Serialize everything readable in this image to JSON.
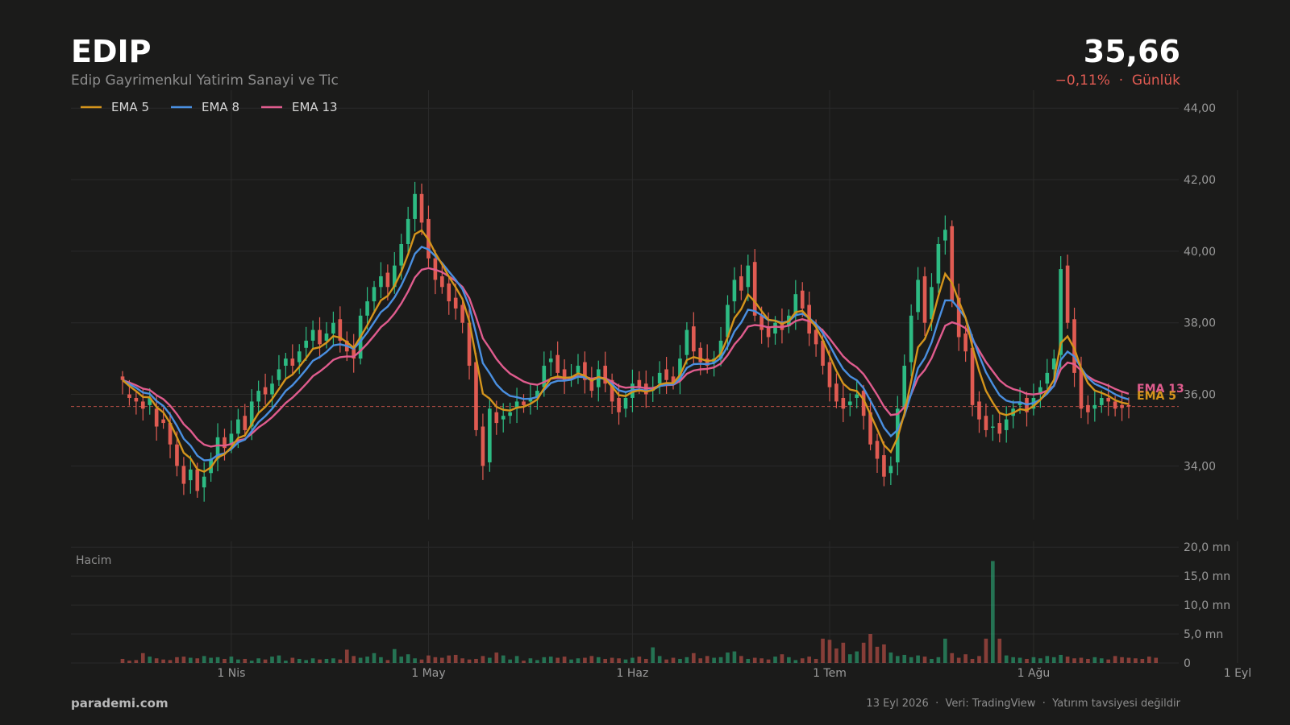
{
  "header": {
    "ticker": "EDIP",
    "company": "Edip Gayrimenkul Yatirim Sanayi ve Tic",
    "price": "35,66",
    "change": "−0,11%",
    "period": "Günlük"
  },
  "footer": {
    "brand": "parademi.com",
    "date": "13 Eyl 2026",
    "source": "Veri: TradingView",
    "disclaimer": "Yatırım tavsiyesi değildir"
  },
  "colors": {
    "up": "#2dbb83",
    "down": "#e05b52",
    "ema5": "#d4941c",
    "ema8": "#4a8fe0",
    "ema13": "#e05c8e",
    "grid": "#2a2a2a",
    "last_price_line": "#e05b52"
  },
  "chart_data": {
    "type": "candlestick",
    "title": "EDIP",
    "ylim": [
      32.5,
      44.5
    ],
    "volume_ylim": [
      0,
      21000000
    ],
    "yticks": [
      "34,00",
      "36,00",
      "38,00",
      "40,00",
      "42,00",
      "44,00"
    ],
    "volume_ticks": [
      "0",
      "5,0 mn",
      "10,0 mn",
      "15,0 mn",
      "20,0 mn"
    ],
    "volume_label": "Hacim",
    "month_labels": [
      "1 Nis",
      "1 May",
      "1 Haz",
      "1 Tem",
      "1 Ağu",
      "1 Eyl"
    ],
    "month_label_positions": [
      16,
      45,
      75,
      104,
      134,
      164
    ],
    "last_price": 35.66,
    "legend": [
      "EMA 5",
      "EMA 8",
      "EMA 13"
    ],
    "legend_placement": "top-left",
    "end_labels": [
      "EMA 13",
      "EMA 5"
    ],
    "close": [
      36.4,
      35.9,
      35.8,
      35.6,
      35.9,
      35.1,
      35.2,
      34.6,
      34.0,
      33.5,
      33.9,
      33.3,
      33.7,
      34.2,
      34.8,
      34.5,
      34.9,
      35.3,
      35.0,
      35.8,
      36.1,
      36.0,
      36.3,
      36.7,
      37.0,
      36.8,
      37.2,
      37.5,
      37.8,
      37.4,
      37.7,
      38.0,
      37.5,
      37.2,
      37.0,
      38.2,
      38.6,
      39.0,
      39.3,
      39.0,
      39.6,
      40.2,
      40.9,
      41.6,
      40.8,
      39.8,
      39.2,
      39.0,
      38.6,
      38.4,
      38.0,
      36.8,
      35.0,
      34.0,
      35.6,
      35.2,
      35.4,
      35.5,
      35.8,
      35.7,
      35.9,
      36.1,
      36.8,
      37.0,
      36.6,
      36.4,
      36.5,
      36.8,
      36.4,
      36.1,
      36.7,
      36.3,
      35.8,
      35.5,
      35.9,
      36.3,
      36.2,
      36.0,
      36.2,
      36.6,
      36.4,
      36.3,
      37.0,
      37.8,
      37.2,
      36.9,
      36.8,
      37.0,
      37.5,
      38.5,
      39.2,
      38.9,
      39.6,
      38.2,
      37.8,
      37.6,
      38.0,
      37.8,
      38.2,
      38.8,
      38.4,
      37.7,
      37.4,
      36.8,
      36.2,
      35.8,
      35.6,
      35.8,
      36.0,
      35.4,
      34.6,
      34.2,
      33.7,
      34.0,
      35.6,
      36.8,
      38.2,
      39.2,
      38.0,
      39.0,
      40.2,
      40.6,
      38.6,
      37.6,
      37.2,
      35.7,
      35.3,
      35.0,
      35.1,
      34.9,
      35.3,
      35.6,
      35.8,
      35.5,
      35.9,
      36.2,
      36.6,
      37.0,
      39.5,
      38.0,
      36.6,
      35.6,
      35.5,
      35.7,
      35.9,
      35.8,
      35.6,
      35.62,
      35.66
    ],
    "open": [
      36.5,
      36.0,
      35.9,
      35.8,
      35.7,
      35.6,
      35.3,
      35.2,
      34.6,
      34.0,
      33.6,
      33.9,
      33.4,
      33.8,
      34.2,
      34.8,
      34.6,
      34.9,
      35.4,
      35.1,
      35.8,
      36.2,
      36.0,
      36.4,
      36.8,
      37.0,
      36.9,
      37.3,
      37.5,
      37.8,
      37.5,
      37.7,
      38.1,
      37.5,
      37.3,
      37.0,
      38.2,
      38.6,
      39.0,
      39.4,
      39.0,
      39.6,
      40.2,
      40.9,
      41.6,
      40.9,
      39.8,
      39.3,
      39.1,
      38.7,
      38.5,
      38.0,
      36.9,
      35.1,
      34.1,
      35.5,
      35.3,
      35.4,
      35.6,
      35.8,
      35.8,
      35.9,
      36.2,
      36.9,
      37.1,
      36.7,
      36.5,
      36.6,
      36.9,
      36.4,
      36.2,
      36.8,
      36.4,
      35.9,
      35.6,
      35.9,
      36.4,
      36.3,
      36.1,
      36.3,
      36.7,
      36.5,
      36.4,
      37.1,
      37.9,
      37.3,
      37.0,
      36.9,
      37.0,
      37.6,
      38.6,
      39.3,
      39.0,
      39.7,
      38.2,
      37.9,
      37.7,
      38.0,
      37.9,
      38.2,
      38.9,
      38.5,
      37.8,
      37.5,
      36.9,
      36.3,
      35.9,
      35.7,
      35.9,
      36.1,
      35.5,
      34.7,
      34.3,
      33.8,
      34.1,
      35.6,
      36.9,
      38.3,
      39.3,
      38.1,
      39.1,
      40.3,
      40.7,
      38.7,
      37.7,
      37.3,
      35.8,
      35.4,
      35.1,
      35.2,
      35.0,
      35.4,
      35.7,
      35.9,
      35.6,
      36.0,
      36.3,
      36.7,
      37.1,
      39.6,
      38.1,
      36.7,
      35.7,
      35.6,
      35.7,
      35.9,
      35.8,
      35.7,
      35.7
    ],
    "volume": [
      700000,
      400000,
      500000,
      1700000,
      1100000,
      800000,
      600000,
      500000,
      1000000,
      1100000,
      900000,
      800000,
      1200000,
      900000,
      1000000,
      700000,
      1100000,
      600000,
      700000,
      400000,
      800000,
      600000,
      1100000,
      1300000,
      400000,
      900000,
      700000,
      500000,
      800000,
      600000,
      700000,
      800000,
      600000,
      2300000,
      1200000,
      900000,
      1100000,
      1700000,
      1000000,
      500000,
      2400000,
      1100000,
      1500000,
      800000,
      600000,
      1300000,
      1000000,
      900000,
      1300000,
      1400000,
      800000,
      600000,
      700000,
      1200000,
      900000,
      1800000,
      1300000,
      600000,
      1200000,
      400000,
      800000,
      500000,
      1000000,
      1100000,
      900000,
      1100000,
      600000,
      800000,
      900000,
      1200000,
      1000000,
      700000,
      900000,
      800000,
      600000,
      900000,
      1100000,
      700000,
      2700000,
      1200000,
      600000,
      900000,
      700000,
      1000000,
      1700000,
      800000,
      1200000,
      900000,
      1000000,
      1800000,
      2000000,
      1200000,
      700000,
      900000,
      800000,
      600000,
      1100000,
      1500000,
      1000000,
      500000,
      800000,
      1100000,
      700000,
      4200000,
      4000000,
      2500000,
      3500000,
      1500000,
      2000000,
      3500000,
      5000000,
      2800000,
      3200000,
      1800000,
      1200000,
      1400000,
      1000000,
      1300000,
      1100000,
      700000,
      1000000,
      4200000,
      1700000,
      900000,
      1500000,
      700000,
      1200000,
      4200000,
      17600000,
      4200000,
      1300000,
      1000000,
      900000,
      700000,
      1000000,
      800000,
      1200000,
      1000000,
      1400000,
      1100000,
      800000,
      900000,
      700000,
      1000000,
      800000,
      600000,
      1200000,
      1000000,
      900000,
      800000,
      700000,
      1100000,
      900000
    ]
  }
}
